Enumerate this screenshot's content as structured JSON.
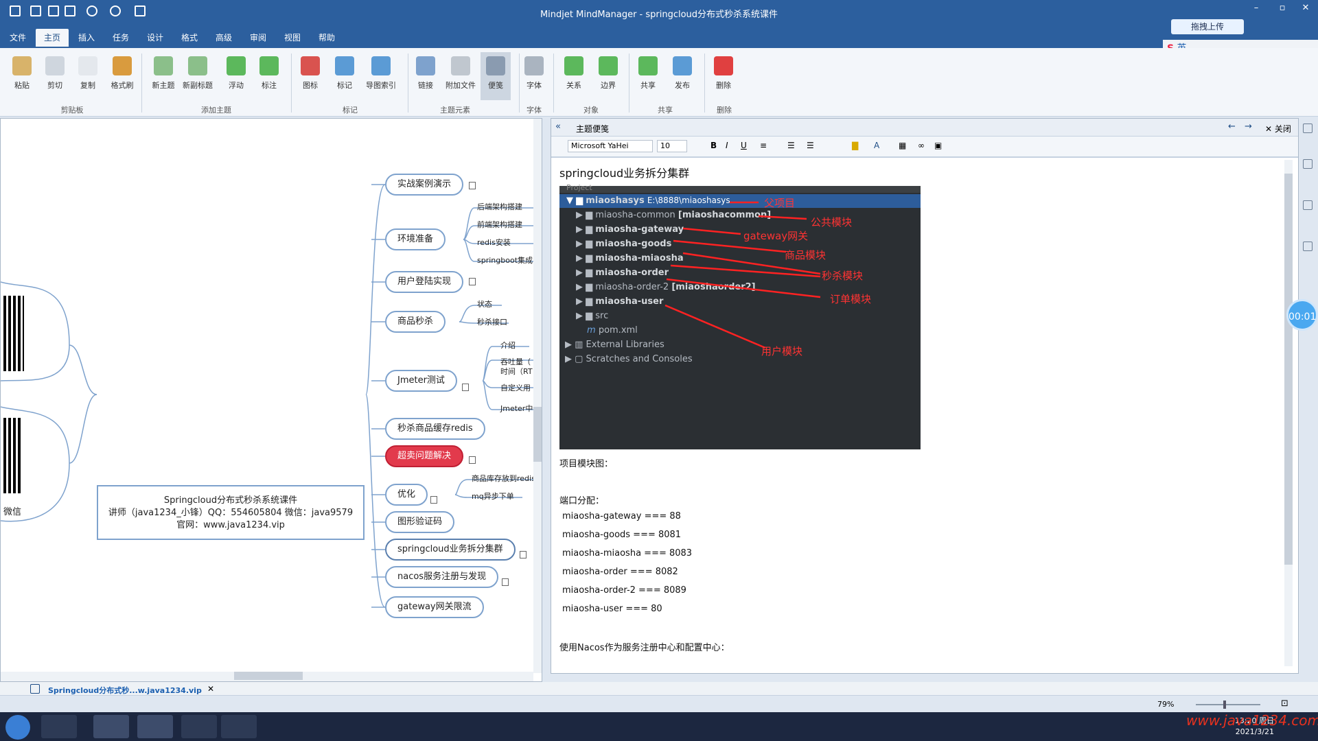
{
  "window": {
    "title": "Mindjet MindManager - springcloud分布式秒杀系统课件",
    "upload_label": "拖拽上传"
  },
  "menu": [
    "文件",
    "主页",
    "插入",
    "任务",
    "设计",
    "格式",
    "高级",
    "审阅",
    "视图",
    "帮助"
  ],
  "menu_active": "主页",
  "ribbon": {
    "buttons": [
      "粘贴",
      "剪切",
      "复制",
      "格式刷",
      "新主题",
      "新副标题",
      "浮动",
      "标注",
      "图标",
      "标记",
      "导图索引",
      "链接",
      "附加文件",
      "便笺",
      "字体",
      "关系",
      "边界",
      "共享",
      "发布",
      "删除"
    ],
    "groups": [
      "剪贴板",
      "添加主题",
      "标记",
      "主题元素",
      "字体",
      "对象",
      "共享",
      "删除"
    ]
  },
  "ime": {
    "label": "英"
  },
  "map": {
    "central": [
      "Springcloud分布式秒杀系统课件",
      "讲师（java1234_小锋）QQ：554605804  微信：java9579",
      "官网：www.java1234.vip"
    ],
    "wechat_label": "微信",
    "topics": [
      "实战案例演示",
      "环境准备",
      "用户登陆实现",
      "商品秒杀",
      "Jmeter测试",
      "秒杀商品缓存redis",
      "超卖问题解决",
      "优化",
      "图形验证码",
      "springcloud业务拆分集群",
      "nacos服务注册与发现",
      "gateway网关限流"
    ],
    "sub_env": [
      "后端架构搭建",
      "前端架构搭建",
      "redis安装",
      "springboot集成"
    ],
    "sub_seckill": [
      "状态",
      "秒杀接口"
    ],
    "sub_jmeter": [
      "介绍",
      "吞吐量（",
      "时间（RT",
      "自定义用",
      "Jmeter中"
    ],
    "sub_opt": [
      "商品库存放到redis",
      "mq异步下单"
    ]
  },
  "doc_tab": {
    "label": "Springcloud分布式秒...w.java1234.vip"
  },
  "notes": {
    "panel_title": "主题便笺",
    "close_label": "关闭",
    "font": "Microsoft YaHei",
    "size": "10",
    "heading": "springcloud业务拆分集群",
    "ide": {
      "header": "Project",
      "root": "miaoshasys",
      "root_path": "E:\\8888\\miaoshasys",
      "items": [
        "miaosha-common",
        "miaosha-gateway",
        "miaosha-goods",
        "miaosha-miaosha",
        "miaosha-order",
        "miaosha-order-2",
        "miaosha-user",
        "src",
        "pom.xml"
      ],
      "common_tag": "[miaoshacommon]",
      "order2_tag": "[miaoshaorder2]",
      "ext": "External Libraries",
      "scratch": "Scratches and Consoles",
      "annotations": [
        "父项目",
        "公共模块",
        "gateway网关",
        "商品模块",
        "秒杀模块",
        "订单模块",
        "用户模块"
      ]
    },
    "lines": [
      "项目模块图：",
      "端口分配：",
      "miaosha-gateway ===  88",
      "miaosha-goods === 8081",
      "miaosha-miaosha === 8083",
      "miaosha-order === 8082",
      "miaosha-order-2 === 8089",
      "miaosha-user === 80",
      "使用Nacos作为服务注册中心和配置中心："
    ]
  },
  "timer": "00:01",
  "status": {
    "zoom": "79%"
  },
  "taskbar": {
    "time": "13:20 周日",
    "date": "2021/3/21",
    "watermark": "www.java1234.com"
  }
}
